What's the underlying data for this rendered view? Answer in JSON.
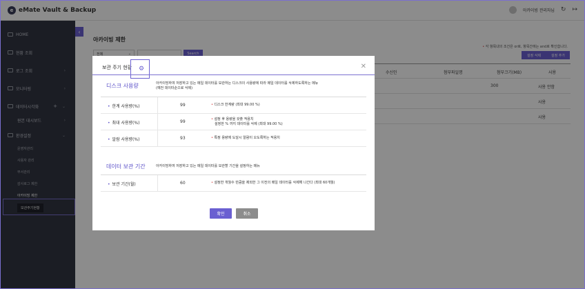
{
  "app": {
    "title": "eMate Vault & Backup",
    "user": "아카이빙 관리자님"
  },
  "sidebar": {
    "items": [
      {
        "label": "HOME"
      },
      {
        "label": "현황 조회"
      },
      {
        "label": "로그 조회"
      },
      {
        "label": "모니터링"
      },
      {
        "label": "데이터시각화"
      },
      {
        "label": "원본 대시보드"
      },
      {
        "label": "환경설정"
      }
    ],
    "sub_items": [
      {
        "label": "운영자관리"
      },
      {
        "label": "사용자 관리"
      },
      {
        "label": "부서관리"
      },
      {
        "label": "감사로그 제한"
      },
      {
        "label": "아카이빙 제한"
      }
    ],
    "selected_sub": "보관주기현황"
  },
  "main": {
    "title": "아카이빙 제한",
    "filter_value": "전체",
    "search_label": "Search",
    "note": "각 항목내의 조건은 or로, 항목간에는 and로 확인합니다.",
    "buttons": {
      "delete": "설정 삭제",
      "add": "설정 추가"
    },
    "table_headers": [
      "수신인",
      "첨부파일명",
      "첨부크기(MB)",
      "사용"
    ],
    "rows": [
      {
        "size": "300",
        "use": "사용 안함"
      },
      {
        "size": "",
        "use": "사용"
      },
      {
        "size": "",
        "use": "사용"
      }
    ]
  },
  "modal": {
    "title": "보관 주기 현황",
    "disk_section": {
      "name": "디스크 사용량",
      "desc_line1": "아카이빙하여 저장하고 있는 메일 데이터를 보관하는 디스크의 사용량에 따라 메일 데이터를 삭제하도록하는 메뉴",
      "desc_line2": "(예전 데이터순으로 삭제)",
      "rows": [
        {
          "label": "한계 사용량(%)",
          "value": "99",
          "desc1": "디스크 한계량 (최대 99.00 %)",
          "desc2": ""
        },
        {
          "label": "최대 사용량(%)",
          "value": "99",
          "desc1": "설정 후 용량을 갖출 적용치",
          "desc2": "설정한 % 까지 데이터를 삭제 (최대 99.00 %)"
        },
        {
          "label": "알람 사용량(%)",
          "value": "93",
          "desc1": "특정 용량에 도달시 알람이 오도록하는 적용치",
          "desc2": ""
        }
      ]
    },
    "retention_section": {
      "name": "데이터 보관 기간",
      "desc": "아카이빙하여 저장하고 있는 메일 데이터를 보관할 기간을 설정하는 메뉴",
      "rows": [
        {
          "label": "보관 기간(월)",
          "value": "60",
          "desc1": "설정한 개월수 만큼을 제외한 그 이전의 메일 데이터를 삭제해 나간다 (최대 60개월)"
        }
      ]
    },
    "ok_label": "확인",
    "cancel_label": "취소"
  }
}
